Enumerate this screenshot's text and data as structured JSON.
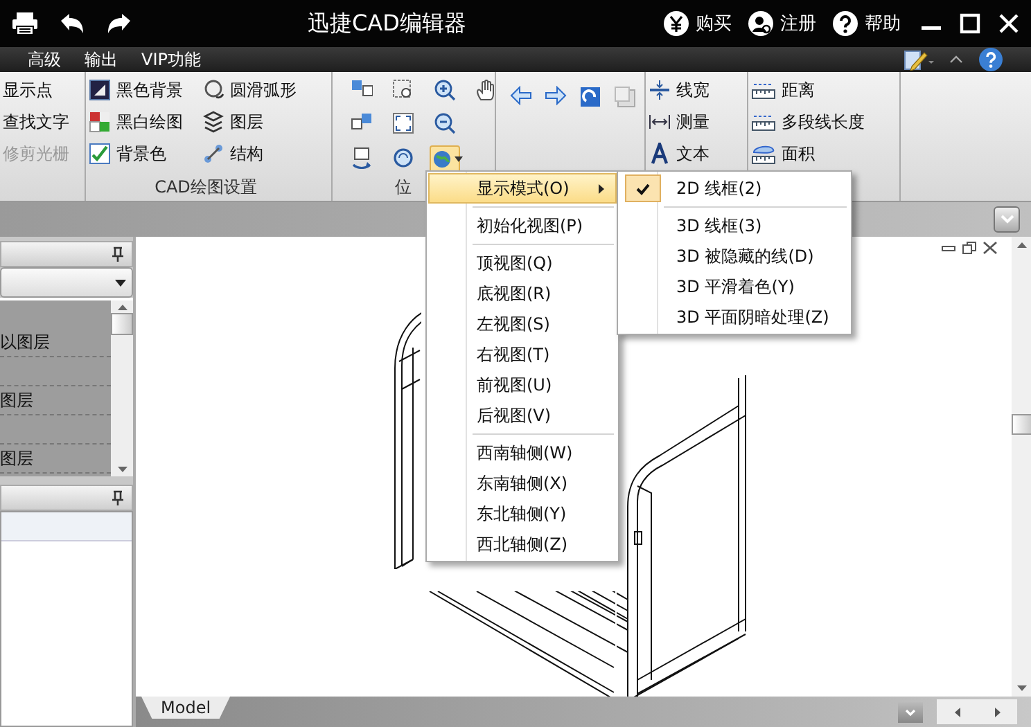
{
  "title_bar": {
    "title": "迅捷CAD编辑器",
    "actions": [
      {
        "kind": "buy",
        "label": "购买"
      },
      {
        "kind": "register",
        "label": "注册"
      },
      {
        "kind": "help",
        "label": "帮助"
      }
    ]
  },
  "menu_bar": {
    "items": [
      {
        "label": "高级"
      },
      {
        "label": "输出"
      },
      {
        "label": "VIP功能"
      }
    ]
  },
  "ribbon": {
    "groups": [
      {
        "kind": "text-tools",
        "columns": [
          [
            {
              "label": "显示点",
              "disabled": false
            },
            {
              "label": "查找文字",
              "disabled": false
            },
            {
              "label": "修剪光栅",
              "disabled": true
            }
          ]
        ]
      },
      {
        "kind": "text-tools",
        "label": "CAD绘图设置",
        "columns": [
          [
            {
              "label": "黑色背景",
              "disabled": false
            },
            {
              "label": "黑白绘图",
              "disabled": false
            },
            {
              "label": "背景色",
              "disabled": false
            }
          ],
          [
            {
              "label": "圆滑弧形",
              "disabled": false
            },
            {
              "label": "图层",
              "disabled": false
            },
            {
              "label": "结构",
              "disabled": false
            }
          ]
        ]
      },
      {
        "kind": "view-icons",
        "label": "位"
      },
      {
        "kind": "nav-icons"
      },
      {
        "kind": "text-tools",
        "columns": [
          [
            {
              "label": "线宽",
              "disabled": false
            },
            {
              "label": "测量",
              "disabled": false
            },
            {
              "label": "文本",
              "disabled": false
            }
          ]
        ]
      },
      {
        "kind": "text-tools",
        "columns": [
          [
            {
              "label": "距离",
              "disabled": false
            },
            {
              "label": "多段线长度",
              "disabled": false
            },
            {
              "label": "面积",
              "disabled": false
            }
          ]
        ]
      }
    ]
  },
  "layers_panel": {
    "rows": [
      {
        "label": "以图层"
      },
      {
        "label": "图层"
      },
      {
        "label": "图层"
      }
    ]
  },
  "context_menu": {
    "items": [
      {
        "kind": "item",
        "label": "显示模式(O)",
        "selected": true,
        "submenu": true
      },
      {
        "kind": "separator"
      },
      {
        "kind": "item",
        "label": "初始化视图(P)",
        "selected": false,
        "submenu": false
      },
      {
        "kind": "separator"
      },
      {
        "kind": "item",
        "label": "顶视图(Q)",
        "selected": false,
        "submenu": false
      },
      {
        "kind": "item",
        "label": "底视图(R)",
        "selected": false,
        "submenu": false
      },
      {
        "kind": "item",
        "label": "左视图(S)",
        "selected": false,
        "submenu": false
      },
      {
        "kind": "item",
        "label": "右视图(T)",
        "selected": false,
        "submenu": false
      },
      {
        "kind": "item",
        "label": "前视图(U)",
        "selected": false,
        "submenu": false
      },
      {
        "kind": "item",
        "label": "后视图(V)",
        "selected": false,
        "submenu": false
      },
      {
        "kind": "separator"
      },
      {
        "kind": "item",
        "label": "西南轴侧(W)",
        "selected": false,
        "submenu": false
      },
      {
        "kind": "item",
        "label": "东南轴侧(X)",
        "selected": false,
        "submenu": false
      },
      {
        "kind": "item",
        "label": "东北轴侧(Y)",
        "selected": false,
        "submenu": false
      },
      {
        "kind": "item",
        "label": "西北轴侧(Z)",
        "selected": false,
        "submenu": false
      }
    ]
  },
  "submenu": {
    "items": [
      {
        "kind": "item",
        "label": "2D 线框(2)",
        "checked": true
      },
      {
        "kind": "separator"
      },
      {
        "kind": "item",
        "label": "3D 线框(3)",
        "checked": false
      },
      {
        "kind": "item",
        "label": "3D 被隐藏的线(D)",
        "checked": false
      },
      {
        "kind": "item",
        "label": "3D 平滑着色(Y)",
        "checked": false
      },
      {
        "kind": "item",
        "label": "3D 平面阴暗处理(Z)",
        "checked": false
      }
    ]
  },
  "layout_tabs": [
    {
      "label": "Model",
      "selected": true
    }
  ]
}
